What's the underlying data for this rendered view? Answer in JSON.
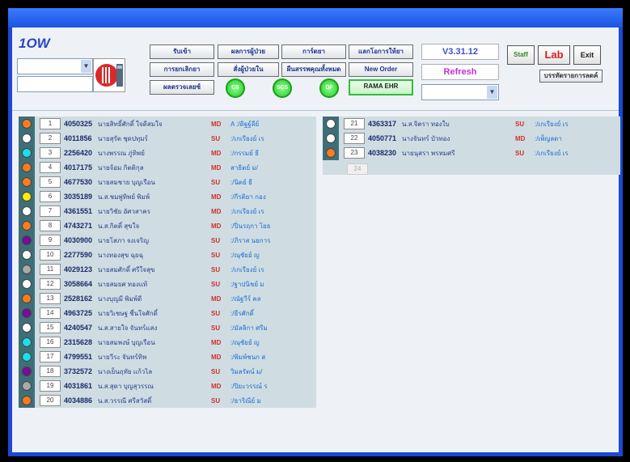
{
  "app": {
    "title": "1OW"
  },
  "version": "V3.31.12",
  "refresh_label": "Refresh",
  "buttons_row1": [
    "รับเข้า",
    "ผลการผู้ป่วย",
    "การ์ดยา",
    "แลกโอการให้ยา"
  ],
  "buttons_row2": [
    "การยกเลิกยา",
    "สั่งผู้ป่วยใน",
    "ผืนสรรพคุณทั้งหมด",
    "New Order"
  ],
  "buttons_row3_first": "ผลตรวจเลยซ์",
  "buttons_row3_last": "RAMA EHR",
  "circle_buttons": [
    "CS",
    "SCS",
    "DF"
  ],
  "right_buttons": {
    "staff": "Staff",
    "lab": "Lab",
    "exit": "Exit",
    "sub": "บรรทัดรายการลดค์"
  },
  "status_colors": {
    "orange": "#ff7b1c",
    "white": "#ffffff",
    "cyan": "#18e0ea",
    "yellow": "#ffee00",
    "purple": "#7a0a9a",
    "gray": "#a9a9a9"
  },
  "left_list": [
    {
      "no": "1",
      "hn": "4050325",
      "name": "นายสิทธิ์ศักดิ์ ใจดีสมใจ",
      "dept": "MD",
      "doc": "A :/ดิฐฐ์ลีย์",
      "color": "orange"
    },
    {
      "no": "2",
      "hn": "4011856",
      "name": "นายสุรัต ชุดปทุมร์",
      "dept": "SU",
      "doc": ":/เกเรียงย์ เร",
      "color": "white"
    },
    {
      "no": "3",
      "hn": "2256420",
      "name": "นางพรรณ ภู่ทิพย์",
      "dept": "MD",
      "doc": ":/กรรมย์ ธี",
      "color": "cyan"
    },
    {
      "no": "4",
      "hn": "4017175",
      "name": "นายจ้อม กิตติกุล",
      "dept": "MD",
      "doc": "สาธิตย์ ม/",
      "color": "orange"
    },
    {
      "no": "5",
      "hn": "4677530",
      "name": "นายสมชาย บุญเรือน",
      "dept": "SU",
      "doc": ":/นิตย์ ธี",
      "color": "orange"
    },
    {
      "no": "6",
      "hn": "3035189",
      "name": "น.ส.ชมพู่ทิพย์ พิมพ์",
      "dept": "MD",
      "doc": ":/กีรติยา กอง",
      "color": "yellow"
    },
    {
      "no": "7",
      "hn": "4361551",
      "name": "นายวิชัย อัศวสาคร",
      "dept": "MD",
      "doc": ":/เกเรียงย์ เร",
      "color": "white"
    },
    {
      "no": "8",
      "hn": "4743271",
      "name": "น.ส.กิตติ์ สุขใจ",
      "dept": "MD",
      "doc": ":/ปิ่นรฤกา โยธ",
      "color": "orange"
    },
    {
      "no": "9",
      "hn": "4030900",
      "name": "นายโสภา จงเจริญ",
      "dept": "SU",
      "doc": ":/ภิราส นยการ",
      "color": "purple"
    },
    {
      "no": "10",
      "hn": "2277590",
      "name": "นางทองสุข ฉุยฉุ",
      "dept": "SU",
      "doc": ":/ณุชัยย์ ญ",
      "color": "white"
    },
    {
      "no": "11",
      "hn": "4029123",
      "name": "นายสมศักดิ์ ศรีใจสุข",
      "dept": "SU",
      "doc": ":/เกเรียงย์ เร",
      "color": "gray"
    },
    {
      "no": "12",
      "hn": "3058664",
      "name": "นายสมยศ ทองแท้",
      "dept": "SU",
      "doc": ":/ฐาปนิชย์ ม",
      "color": "white"
    },
    {
      "no": "13",
      "hn": "2528162",
      "name": "นางบุญมี พิมพ์ดี",
      "dept": "MD",
      "doc": ":/ณัฐวีร์ คล",
      "color": "orange"
    },
    {
      "no": "14",
      "hn": "4963725",
      "name": "นายวิเชษฐ ชื่นใจศักดิ์",
      "dept": "SU",
      "doc": ":/ธีรศักดิ์",
      "color": "purple"
    },
    {
      "no": "15",
      "hn": "4240547",
      "name": "น.ส.สายใจ จันทร์แสง",
      "dept": "SU",
      "doc": ":/มัลลิกา ศรีม",
      "color": "white"
    },
    {
      "no": "16",
      "hn": "2315628",
      "name": "นายสมพงษ์ บุญเรือน",
      "dept": "MD",
      "doc": ":/ณุชัยย์ ญ",
      "color": "cyan"
    },
    {
      "no": "17",
      "hn": "4799551",
      "name": "นายวีระ จันทร์ทิพ",
      "dept": "MD",
      "doc": ":/พิมพ์ชนก ส",
      "color": "cyan"
    },
    {
      "no": "18",
      "hn": "3732572",
      "name": "นางเย็นฤทัย แก้วไล",
      "dept": "SU",
      "doc": "วิมลรัตน์ ม/",
      "color": "purple"
    },
    {
      "no": "19",
      "hn": "4031861",
      "name": "น.ส.สุดา บุญสุวรรณ",
      "dept": "MD",
      "doc": ":/ปิยะวรรณ์ ร",
      "color": "gray"
    },
    {
      "no": "20",
      "hn": "4034886",
      "name": "น.ส.วรรณี ศรีสวัสดิ์",
      "dept": "SU",
      "doc": ":/ธาริณีย์ ม",
      "color": "orange"
    }
  ],
  "right_list": [
    {
      "no": "21",
      "hn": "4363317",
      "name": "น.ส.จิตรา ทองใบ",
      "dept": "SU",
      "doc": ":/เกเรียงย์ เร",
      "color": "white"
    },
    {
      "no": "22",
      "hn": "4050771",
      "name": "นางจันทร์ บัวทอง",
      "dept": "MD",
      "doc": ":/เพ็ญลดา",
      "color": "white"
    },
    {
      "no": "23",
      "hn": "4038230",
      "name": "นายนุสรา พรหมศรี",
      "dept": "SU",
      "doc": ":/เกเรียงย์ เร",
      "color": "orange"
    }
  ],
  "next_slot": "24"
}
